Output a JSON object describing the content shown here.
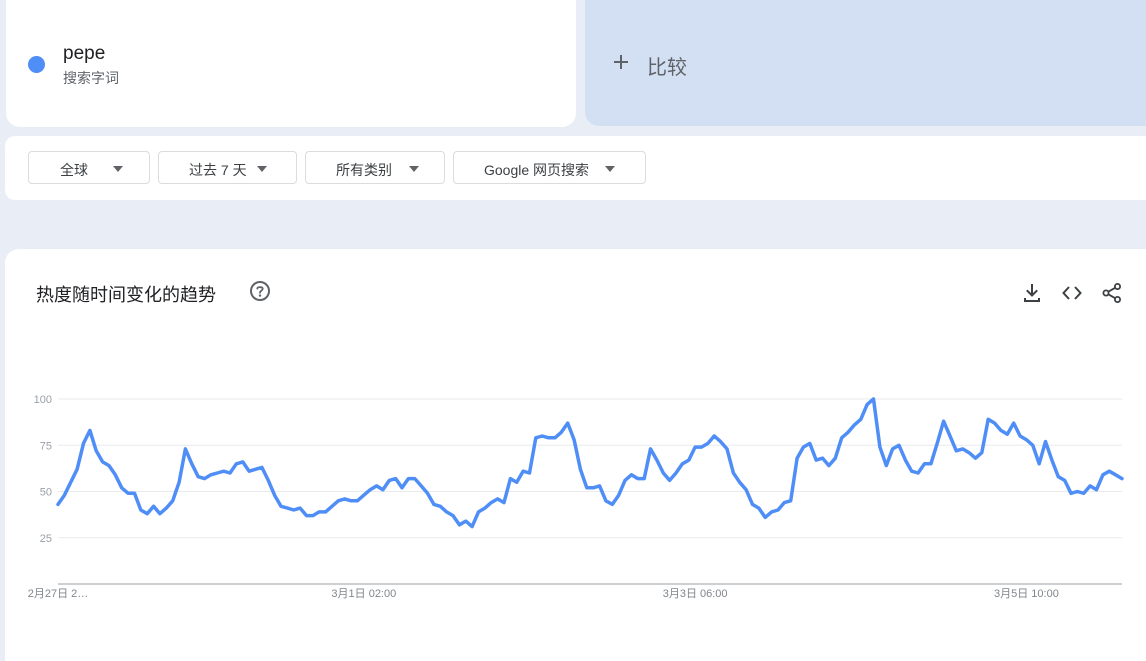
{
  "search_term": {
    "name": "pepe",
    "subtitle": "搜索字词",
    "color": "#4f8ef7"
  },
  "compare": {
    "label": "比较"
  },
  "filters": {
    "region": "全球",
    "time": "过去 7 天",
    "category": "所有类别",
    "property": "Google 网页搜索"
  },
  "chart_section": {
    "title": "热度随时间变化的趋势",
    "icons": [
      "help-icon",
      "download-icon",
      "embed-icon",
      "share-icon"
    ]
  },
  "chart_data": {
    "type": "line",
    "title": "热度随时间变化的趋势",
    "line_color": "#4f8ef7",
    "ylim": [
      0,
      100
    ],
    "y_ticks": [
      25,
      50,
      75,
      100
    ],
    "grid": true,
    "x_tick_labels": [
      {
        "label": "2月27日 2…",
        "index": 0
      },
      {
        "label": "3月1日 02:00",
        "index": 48
      },
      {
        "label": "3月3日 06:00",
        "index": 100
      },
      {
        "label": "3月5日 10:00",
        "index": 152
      }
    ],
    "series": [
      {
        "values": [
          43,
          48,
          55,
          62,
          76,
          83,
          72,
          66,
          64,
          59,
          52,
          49,
          49,
          40,
          38,
          42,
          38,
          41,
          45,
          55,
          73,
          65,
          58,
          57,
          59,
          60,
          61,
          60,
          65,
          66,
          61,
          62,
          63,
          56,
          48,
          42,
          41,
          40,
          41,
          37,
          37,
          39,
          39,
          42,
          45,
          46,
          45,
          45,
          48,
          51,
          53,
          51,
          56,
          57,
          52,
          57,
          57,
          53,
          49,
          43,
          42,
          39,
          37,
          32,
          34,
          31,
          39,
          41,
          44,
          46,
          44,
          57,
          55,
          61,
          60,
          79,
          80,
          79,
          79,
          82,
          87,
          78,
          62,
          52,
          52,
          53,
          45,
          43,
          48,
          56,
          59,
          57,
          57,
          73,
          67,
          60,
          56,
          60,
          65,
          67,
          74,
          74,
          76,
          80,
          77,
          73,
          60,
          55,
          51,
          43,
          41,
          36,
          39,
          40,
          44,
          45,
          68,
          74,
          76,
          67,
          68,
          64,
          68,
          79,
          82,
          86,
          89,
          97,
          100,
          74,
          64,
          73,
          75,
          67,
          61,
          60,
          65,
          65,
          76,
          88,
          80,
          72,
          73,
          71,
          68,
          71,
          89,
          87,
          83,
          81,
          87,
          80,
          78,
          75,
          65,
          77,
          67,
          58,
          56,
          49,
          50,
          49,
          53,
          51,
          59,
          61,
          59,
          57
        ]
      }
    ]
  }
}
